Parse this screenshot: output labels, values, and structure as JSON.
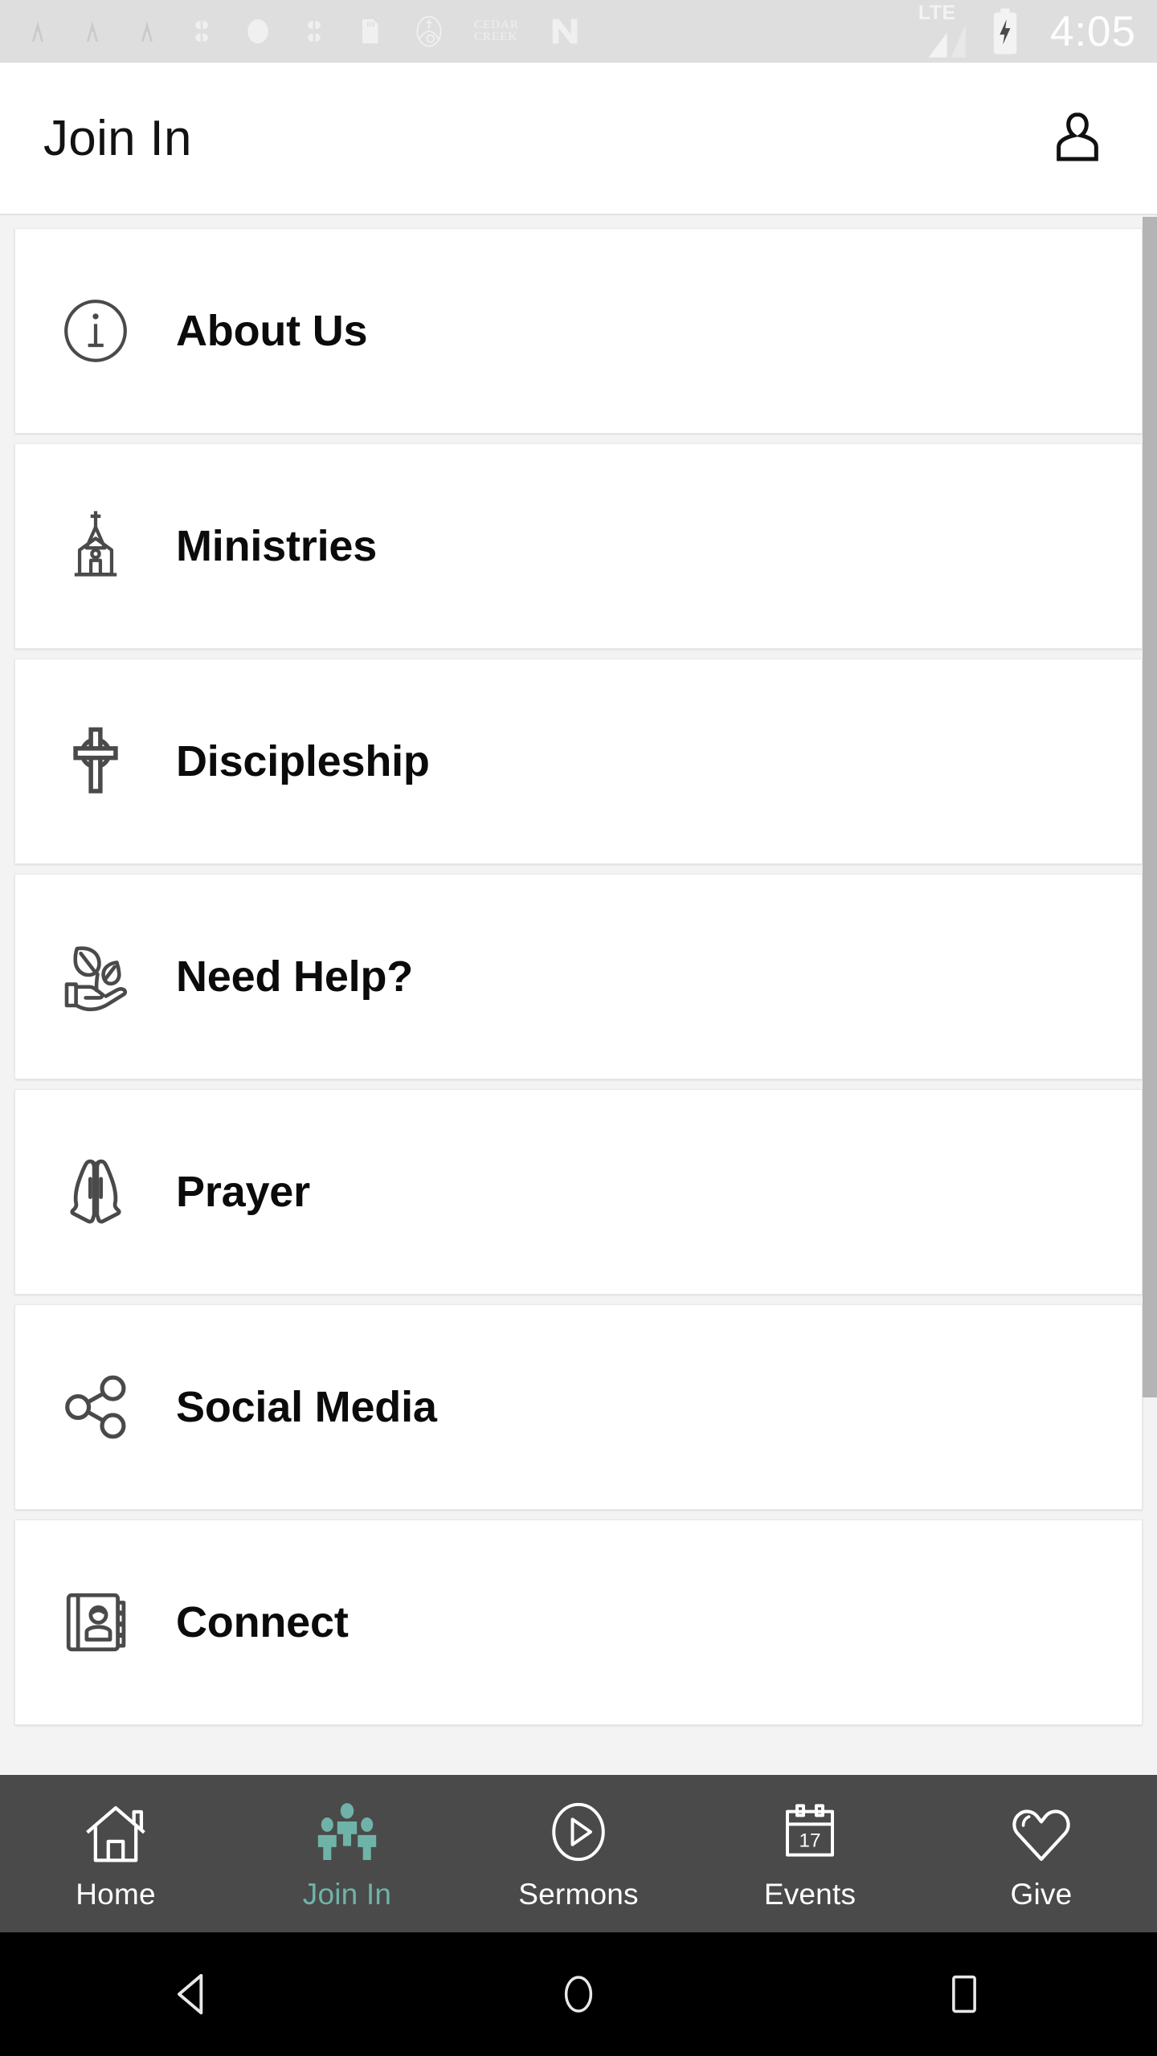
{
  "statusbar": {
    "time": "4:05",
    "network_label": "LTE",
    "icons": [
      "signal-tower-faint-icon",
      "signal-tower-faint-icon",
      "signal-tower-faint-icon",
      "puzzle-icon",
      "circle-icon",
      "puzzle-icon",
      "sd-card-icon",
      "church-logo-icon",
      "cedar-creek-wordmark-icon",
      "nextdoor-n-icon"
    ],
    "battery": "battery-charging-icon",
    "signal": "signal-bars-icon"
  },
  "appbar": {
    "title": "Join In",
    "action_icon": "profile-person-icon"
  },
  "menu": {
    "items": [
      {
        "label": "About Us",
        "icon": "info-circle-icon"
      },
      {
        "label": "Ministries",
        "icon": "church-icon"
      },
      {
        "label": "Discipleship",
        "icon": "cross-icon"
      },
      {
        "label": "Need Help?",
        "icon": "hand-sprout-icon"
      },
      {
        "label": "Prayer",
        "icon": "praying-hands-icon"
      },
      {
        "label": "Social Media",
        "icon": "share-network-icon"
      },
      {
        "label": "Connect",
        "icon": "address-book-icon"
      }
    ]
  },
  "bottomnav": {
    "active_index": 1,
    "accent_color": "#6fb3a8",
    "background_color": "#4a4a4a",
    "items": [
      {
        "label": "Home",
        "icon": "house-icon"
      },
      {
        "label": "Join In",
        "icon": "people-group-icon"
      },
      {
        "label": "Sermons",
        "icon": "play-circle-icon"
      },
      {
        "label": "Events",
        "icon": "calendar-icon",
        "badge": "17"
      },
      {
        "label": "Give",
        "icon": "heart-icon"
      }
    ]
  },
  "androidnav": {
    "back": "back-triangle-icon",
    "home": "home-circle-icon",
    "recents": "recents-square-icon"
  }
}
